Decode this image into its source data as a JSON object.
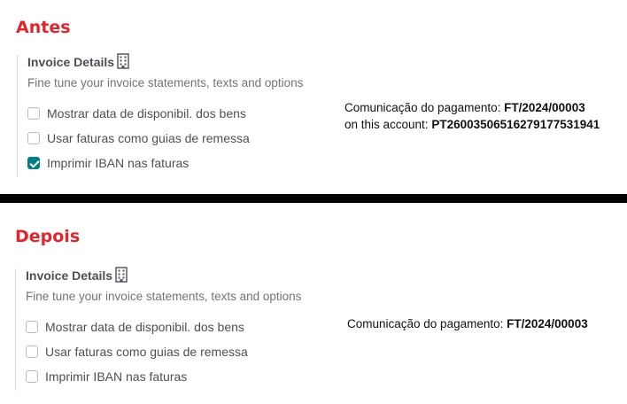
{
  "before": {
    "heading": "Antes",
    "panel": {
      "title": "Invoice Details",
      "subtitle": "Fine tune your invoice statements, texts and options",
      "icon": "building-icon",
      "options": [
        {
          "label": "Mostrar data de disponibil. dos bens",
          "checked": false
        },
        {
          "label": "Usar faturas como guias de remessa",
          "checked": false
        },
        {
          "label": "Imprimir IBAN nas faturas",
          "checked": true
        }
      ]
    },
    "preview": {
      "comm_label": "Comunicação do pagamento:",
      "comm_value": "FT/2024/00003",
      "account_label": "on this account:",
      "account_value": "PT26003506516279177531941"
    }
  },
  "after": {
    "heading": "Depois",
    "panel": {
      "title": "Invoice Details",
      "subtitle": "Fine tune your invoice statements, texts and options",
      "icon": "building-icon",
      "options": [
        {
          "label": "Mostrar data de disponibil. dos bens",
          "checked": false
        },
        {
          "label": "Usar faturas como guias de remessa",
          "checked": false
        },
        {
          "label": "Imprimir IBAN nas faturas",
          "checked": false
        }
      ]
    },
    "preview": {
      "comm_label": "Comunicação do pagamento:",
      "comm_value": "FT/2024/00003"
    }
  },
  "colors": {
    "heading": "#e0262d",
    "checkbox_checked": "#017e84",
    "divider": "#000000"
  }
}
